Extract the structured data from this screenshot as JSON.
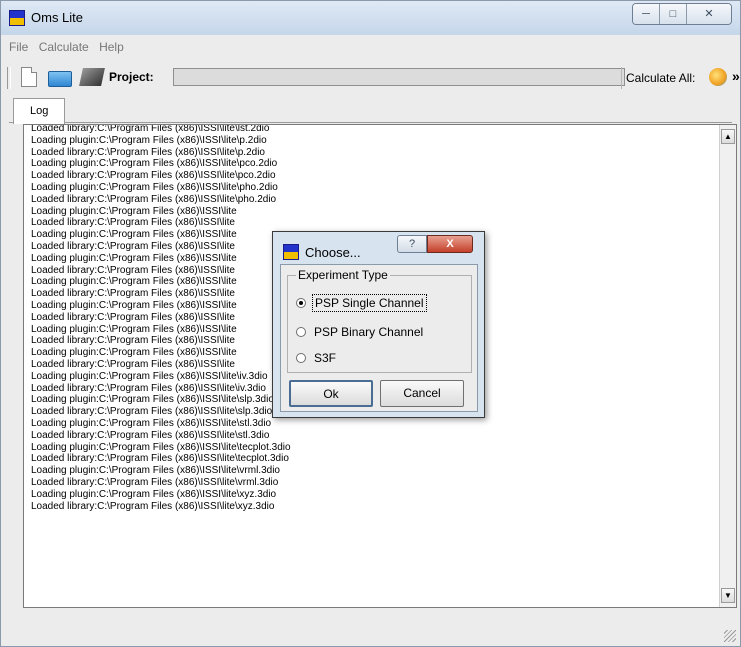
{
  "window": {
    "title": "Oms Lite"
  },
  "menu": [
    "File",
    "Calculate",
    "Help"
  ],
  "toolbar": {
    "project_label": "Project:",
    "project_value": "",
    "calculate_all_label": "Calculate All:",
    "more_glyph": "»"
  },
  "tabs": [
    {
      "label": "Log",
      "active": true
    }
  ],
  "log_lines": [
    "Loaded library:C:\\Program Files (x86)\\ISSI\\lite\\lst.2dio",
    "Loading plugin:C:\\Program Files (x86)\\ISSI\\lite\\p.2dio",
    "Loaded library:C:\\Program Files (x86)\\ISSI\\lite\\p.2dio",
    "Loading plugin:C:\\Program Files (x86)\\ISSI\\lite\\pco.2dio",
    "Loaded library:C:\\Program Files (x86)\\ISSI\\lite\\pco.2dio",
    "Loading plugin:C:\\Program Files (x86)\\ISSI\\lite\\pho.2dio",
    "Loaded library:C:\\Program Files (x86)\\ISSI\\lite\\pho.2dio",
    "Loading plugin:C:\\Program Files (x86)\\ISSI\\lite",
    "Loaded library:C:\\Program Files (x86)\\ISSI\\lite",
    "Loading plugin:C:\\Program Files (x86)\\ISSI\\lite",
    "Loaded library:C:\\Program Files (x86)\\ISSI\\lite",
    "Loading plugin:C:\\Program Files (x86)\\ISSI\\lite",
    "Loaded library:C:\\Program Files (x86)\\ISSI\\lite",
    "Loading plugin:C:\\Program Files (x86)\\ISSI\\lite",
    "Loaded library:C:\\Program Files (x86)\\ISSI\\lite",
    "Loading plugin:C:\\Program Files (x86)\\ISSI\\lite",
    "Loaded library:C:\\Program Files (x86)\\ISSI\\lite",
    "Loading plugin:C:\\Program Files (x86)\\ISSI\\lite",
    "Loaded library:C:\\Program Files (x86)\\ISSI\\lite",
    "Loading plugin:C:\\Program Files (x86)\\ISSI\\lite",
    "Loaded library:C:\\Program Files (x86)\\ISSI\\lite",
    "Loading plugin:C:\\Program Files (x86)\\ISSI\\lite\\iv.3dio",
    "Loaded library:C:\\Program Files (x86)\\ISSI\\lite\\iv.3dio",
    "Loading plugin:C:\\Program Files (x86)\\ISSI\\lite\\slp.3dio",
    "Loaded library:C:\\Program Files (x86)\\ISSI\\lite\\slp.3dio",
    "Loading plugin:C:\\Program Files (x86)\\ISSI\\lite\\stl.3dio",
    "Loaded library:C:\\Program Files (x86)\\ISSI\\lite\\stl.3dio",
    "Loading plugin:C:\\Program Files (x86)\\ISSI\\lite\\tecplot.3dio",
    "Loaded library:C:\\Program Files (x86)\\ISSI\\lite\\tecplot.3dio",
    "Loading plugin:C:\\Program Files (x86)\\ISSI\\lite\\vrml.3dio",
    "Loaded library:C:\\Program Files (x86)\\ISSI\\lite\\vrml.3dio",
    "Loading plugin:C:\\Program Files (x86)\\ISSI\\lite\\xyz.3dio",
    "Loaded library:C:\\Program Files (x86)\\ISSI\\lite\\xyz.3dio"
  ],
  "dialog": {
    "title": "Choose...",
    "help_glyph": "?",
    "close_glyph": "X",
    "group_label": "Experiment Type",
    "options": [
      "PSP Single Channel",
      "PSP Binary Channel",
      "S3F"
    ],
    "selected_option": "PSP Single Channel",
    "ok_label": "Ok",
    "cancel_label": "Cancel"
  },
  "icons": {
    "app": "app-logo-icon",
    "new": "new-file-icon",
    "open": "open-folder-icon",
    "save": "save-icon",
    "calculate": "calculate-all-icon",
    "scroll_up": "scroll-up-icon",
    "scroll_down": "scroll-down-icon"
  },
  "colors": {
    "titlebar": "#c5d6ea",
    "dialog_close": "#c4402a",
    "app_icon_blue": "#2233cc",
    "app_icon_yellow": "#f0c000"
  }
}
